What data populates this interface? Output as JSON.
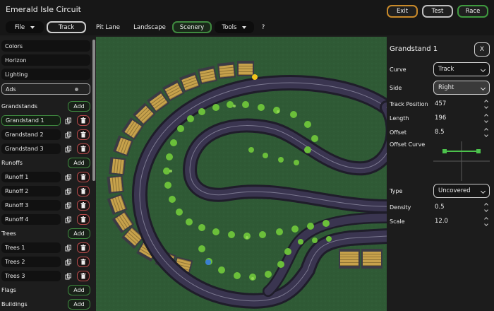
{
  "app": {
    "title": "Emerald Isle Circuit"
  },
  "title_buttons": {
    "exit": "Exit",
    "test": "Test",
    "race": "Race"
  },
  "menu": {
    "file": "File",
    "track": "Track",
    "pit_lane": "Pit Lane",
    "landscape": "Landscape",
    "scenery": "Scenery",
    "tools": "Tools",
    "help": "?"
  },
  "left_top": [
    "Colors",
    "Horizon",
    "Lighting",
    "Ads"
  ],
  "sections": {
    "grandstands": {
      "title": "Grandstands",
      "add": "Add",
      "items": [
        "Grandstand 1",
        "Grandstand 2",
        "Grandstand 3"
      ]
    },
    "runoffs": {
      "title": "Runoffs",
      "add": "Add",
      "items": [
        "Runoff 1",
        "Runoff 2",
        "Runoff 3",
        "Runoff 4"
      ]
    },
    "trees": {
      "title": "Trees",
      "add": "Add",
      "items": [
        "Trees 1",
        "Trees 2",
        "Trees 3"
      ]
    },
    "flags": {
      "title": "Flags",
      "add": "Add"
    },
    "buildings": {
      "title": "Buildings",
      "add": "Add"
    }
  },
  "inspector": {
    "title": "Grandstand 1",
    "close": "X",
    "curve_label": "Curve",
    "curve_value": "Track",
    "side_label": "Side",
    "side_value": "Right",
    "track_position_label": "Track Position",
    "track_position": "457",
    "length_label": "Length",
    "length": "196",
    "offset_label": "Offset",
    "offset": "8.5",
    "offset_curve_label": "Offset Curve",
    "type_label": "Type",
    "type_value": "Uncovered",
    "density_label": "Density",
    "density": "0.5",
    "scale_label": "Scale",
    "scale": "12.0"
  },
  "colors": {
    "accent_green": "#3f8a3f",
    "exit_orange": "#c98a2a",
    "delete_red": "#b44a4a",
    "grass": "#2f5a35"
  }
}
